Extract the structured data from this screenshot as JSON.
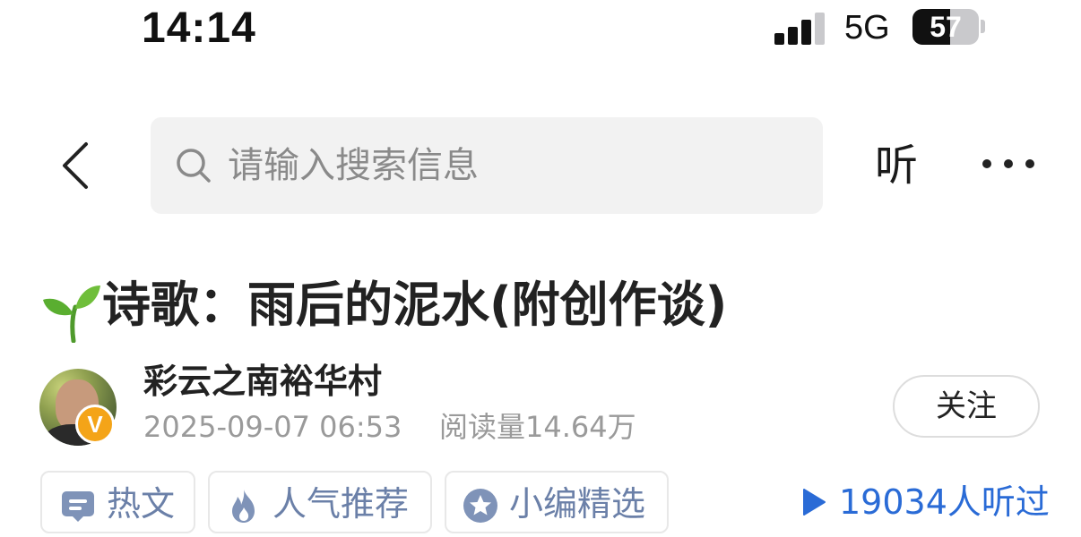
{
  "status_bar": {
    "time": "14:14",
    "network": "5G",
    "battery_level": "57",
    "battery_fraction": 0.57,
    "signal_bars": 3,
    "icons": [
      "signal-icon",
      "battery-icon"
    ]
  },
  "nav": {
    "back_icon": "chevron-left-icon",
    "search_placeholder": "请输入搜索信息",
    "search_icon": "search-icon",
    "listen_label": "听",
    "more_icon": "more-dots-icon"
  },
  "article": {
    "title_icon": "sprout-icon",
    "title": "诗歌：雨后的泥水(附创作谈)"
  },
  "author": {
    "name": "彩云之南裕华村",
    "badge": "V",
    "publish_time": "2025-09-07 06:53",
    "read_count": "阅读量14.64万",
    "follow_label": "关注"
  },
  "tags": [
    {
      "icon": "article-icon",
      "label": "热文"
    },
    {
      "icon": "fire-icon",
      "label": "人气推荐"
    },
    {
      "icon": "star-badge-icon",
      "label": "小编精选"
    }
  ],
  "listen": {
    "icon": "play-icon",
    "label": "19034人听过"
  },
  "colors": {
    "tag_text": "#6b80a8",
    "listen_text": "#2a6bd6",
    "badge": "#f4a418",
    "search_bg": "#f2f2f2"
  }
}
